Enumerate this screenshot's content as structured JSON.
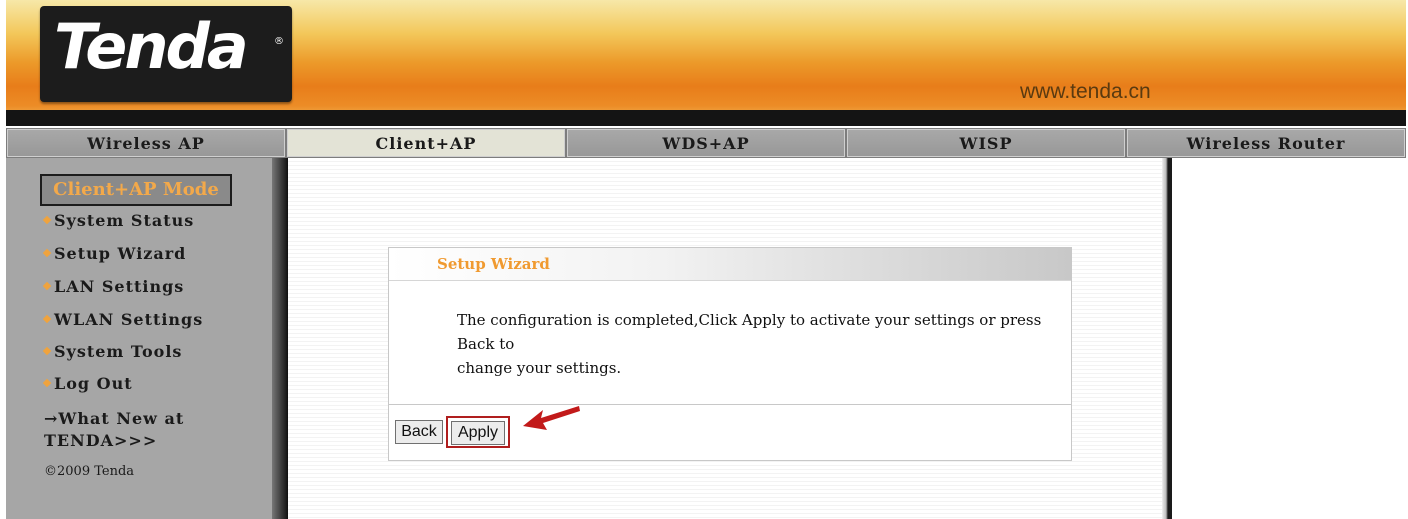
{
  "header": {
    "logo_text": "Tenda",
    "logo_reg": "®",
    "url": "www.tenda.cn"
  },
  "tabs": [
    {
      "label": "Wireless AP",
      "active": false
    },
    {
      "label": "Client+AP",
      "active": true
    },
    {
      "label": "WDS+AP",
      "active": false
    },
    {
      "label": "WISP",
      "active": false
    },
    {
      "label": "Wireless Router",
      "active": false
    }
  ],
  "sidebar": {
    "mode_title": "Client+AP Mode",
    "items": [
      {
        "label": "System Status"
      },
      {
        "label": "Setup Wizard"
      },
      {
        "label": "LAN Settings"
      },
      {
        "label": "WLAN Settings"
      },
      {
        "label": "System Tools"
      },
      {
        "label": "Log Out"
      }
    ],
    "whats_new_line1": "→What New at",
    "whats_new_line2": "TENDA>>>",
    "copyright": "©2009 Tenda"
  },
  "wizard": {
    "title": "Setup Wizard",
    "message_line1": "The configuration is completed,Click Apply to activate your settings or press Back to",
    "message_line2": "change your settings.",
    "back_label": "Back",
    "apply_label": "Apply"
  },
  "colors": {
    "accent_orange": "#f09a30",
    "highlight_red": "#b01e1e",
    "banner_orange": "#e87d1a"
  },
  "icons": {
    "arrow": "red-pointer-arrow-icon"
  }
}
